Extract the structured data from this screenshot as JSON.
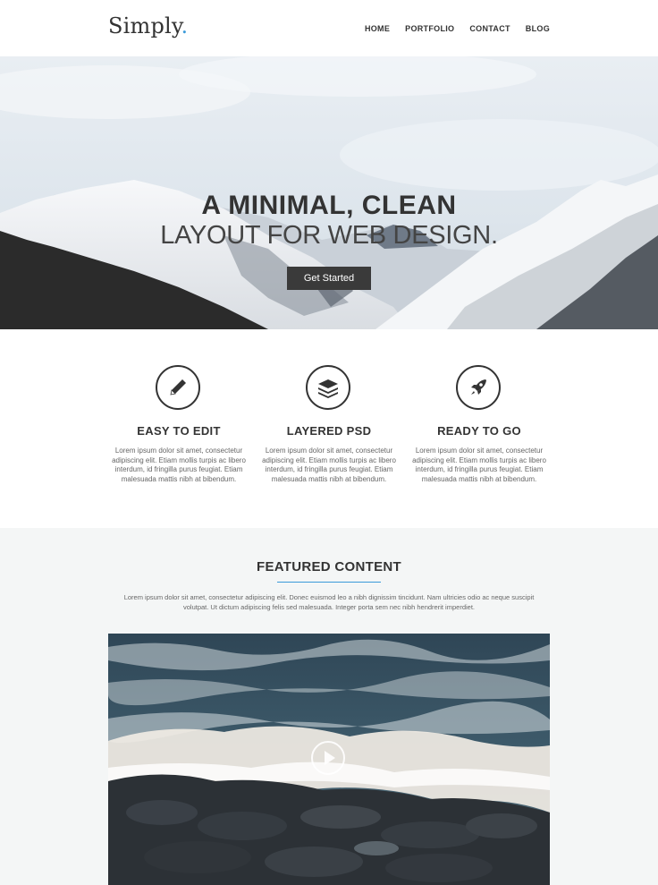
{
  "header": {
    "logo_text": "Simply",
    "logo_dot": ".",
    "nav": [
      "HOME",
      "PORTFOLIO",
      "CONTACT",
      "BLOG"
    ]
  },
  "hero": {
    "title": "A MINIMAL, CLEAN",
    "subtitle": "LAYOUT FOR WEB DESIGN.",
    "cta_label": "Get Started"
  },
  "features": [
    {
      "icon": "pen-icon",
      "title": "EASY TO EDIT",
      "text": "Lorem ipsum dolor sit amet, consectetur adipiscing elit. Etiam mollis turpis ac libero interdum, id fringilla purus feugiat. Etiam malesuada mattis nibh at bibendum."
    },
    {
      "icon": "layers-icon",
      "title": "LAYERED PSD",
      "text": "Lorem ipsum dolor sit amet, consectetur adipiscing elit. Etiam mollis turpis ac libero interdum, id fringilla purus feugiat. Etiam malesuada mattis nibh at bibendum."
    },
    {
      "icon": "rocket-icon",
      "title": "READY TO GO",
      "text": "Lorem ipsum dolor sit amet, consectetur adipiscing elit. Etiam mollis turpis ac libero interdum, id fringilla purus feugiat. Etiam malesuada mattis nibh at bibendum."
    }
  ],
  "featured": {
    "heading": "FEATURED CONTENT",
    "description": "Lorem ipsum dolor sit amet, consectetur adipiscing elit. Donec euismod leo a nibh dignissim tincidunt. Nam ultricies odio ac neque suscipit volutpat. Ut dictum adipiscing felis sed malesuada. Integer porta sem nec nibh hendrerit imperdiet.",
    "video_icon": "play-icon"
  },
  "colors": {
    "accent": "#3a9ad9",
    "dark": "#333333",
    "button": "#3a3a3a",
    "section_bg": "#f4f6f6"
  }
}
